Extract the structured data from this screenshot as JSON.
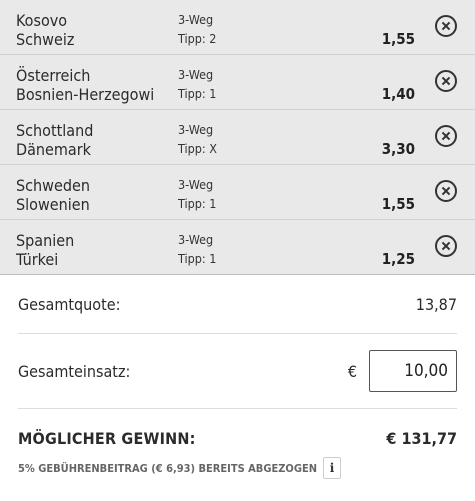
{
  "bets": [
    {
      "home": "Kosovo",
      "away": "Schweiz",
      "market": "3-Weg",
      "tip": "Tipp: 2",
      "odds": "1,55"
    },
    {
      "home": "Österreich",
      "away": "Bosnien-Herzegowi",
      "market": "3-Weg",
      "tip": "Tipp: 1",
      "odds": "1,40"
    },
    {
      "home": "Schottland",
      "away": "Dänemark",
      "market": "3-Weg",
      "tip": "Tipp: X",
      "odds": "3,30"
    },
    {
      "home": "Schweden",
      "away": "Slowenien",
      "market": "3-Weg",
      "tip": "Tipp: 1",
      "odds": "1,55"
    },
    {
      "home": "Spanien",
      "away": "Türkei",
      "market": "3-Weg",
      "tip": "Tipp: 1",
      "odds": "1,25"
    }
  ],
  "summary": {
    "total_odds_label": "Gesamtquote:",
    "total_odds_value": "13,87",
    "stake_label": "Gesamteinsatz:",
    "currency": "€",
    "stake_value": "10,00",
    "win_label": "MÖGLICHER GEWINN:",
    "win_value": "€ 131,77",
    "fee_text": "5% GEBÜHRENBEITRAG (€ 6,93) BEREITS ABGEZOGEN",
    "info_label": "i"
  },
  "icons": {
    "remove": "close-circle-icon",
    "info": "info-icon"
  },
  "colors": {
    "bets_background": "#e9e9e9",
    "text": "#2b2b2b"
  }
}
